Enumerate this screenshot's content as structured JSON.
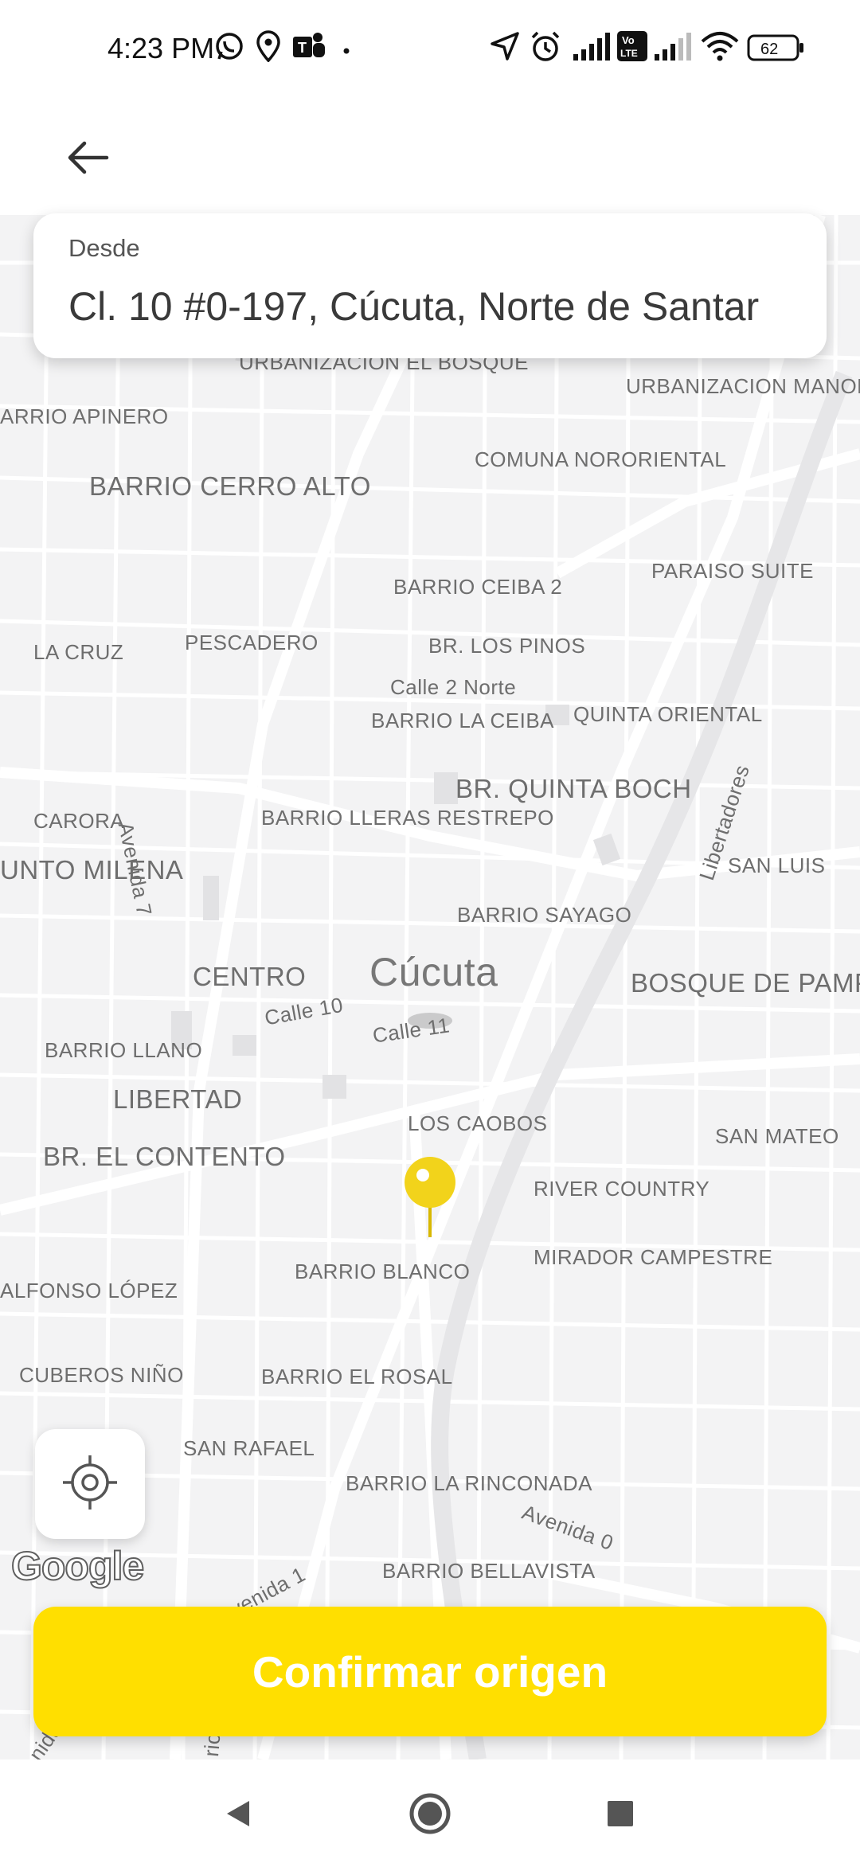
{
  "status_bar": {
    "time": "4:23 PM",
    "battery_level": "62",
    "network_badge": "Vo LTE",
    "icons": [
      "whatsapp-icon",
      "location-pin-icon",
      "teams-icon",
      "dot-icon",
      "navigation-arrow-icon",
      "alarm-icon",
      "signal-icon",
      "volte-icon",
      "signal-icon",
      "wifi-icon",
      "battery-icon"
    ]
  },
  "header": {
    "back_icon": "back-arrow-icon"
  },
  "origin": {
    "label": "Desde",
    "value": "Cl. 10 #0-197, Cúcuta, Norte de Santar"
  },
  "map": {
    "city_label": "Cúcuta",
    "labels": [
      "URBANIZACION EL BOSQUE",
      "URBANIZACION MANOLO LEMUS",
      "ARRIO APINERO",
      "BARRIO CERRO ALTO",
      "COMUNA NORORIENTAL",
      "BARRIO CEIBA 2",
      "PARAISO SUITE",
      "LA CRUZ",
      "PESCADERO",
      "BR. LOS PINOS",
      "Calle 2 Norte",
      "BARRIO LA CEIBA",
      "QUINTA ORIENTAL",
      "CARORA",
      "Avenida 7",
      "BARRIO LLERAS RESTREPO",
      "BR. QUINTA BOCH",
      "Libertadores",
      "SAN LUIS",
      "UNTO MILENA",
      "BARRIO SAYAGO",
      "CENTRO",
      "BOSQUE DE PAMPLONITA",
      "Calle 10",
      "Calle 11",
      "BARRIO LLANO",
      "LIBERTAD",
      "LOS CAOBOS",
      "SAN MATEO",
      "BR. EL CONTENTO",
      "RIVER COUNTRY",
      "MIRADOR CAMPESTRE",
      "BARRIO BLANCO",
      "ALFONSO LÓPEZ",
      "CUBEROS NIÑO",
      "BARRIO EL ROSAL",
      "SAN RAFAEL",
      "BARRIO LA RINCONADA",
      "Avenida 0",
      "BARRIO BELLAVISTA",
      "venida 1",
      "nida",
      "rio"
    ],
    "locate_icon": "my-location-icon",
    "attribution": "Google"
  },
  "confirm": {
    "label": "Confirmar origen"
  },
  "nav": {
    "icons": [
      "nav-back-icon",
      "nav-home-icon",
      "nav-recents-icon"
    ]
  },
  "colors": {
    "accent": "#FFDF00",
    "map_background": "#F3F3F4",
    "map_road": "#FFFFFF",
    "map_label": "#6E6E6E",
    "pin": "#F2D31B"
  }
}
